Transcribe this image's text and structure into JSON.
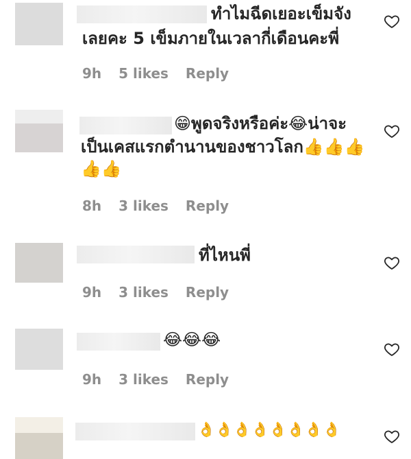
{
  "comments": [
    {
      "text_line1": "ทำไมฉีดเยอะเข็มจัง",
      "text_line2": "เลยคะ 5 เข็มภายในเวลากี่เดือนคะพี่",
      "time": "9h",
      "likes": "5 likes",
      "reply": "Reply",
      "icon": "heart-outline-icon"
    },
    {
      "text_line1": "😁พูดจริงหรือค่ะ😂น่าจะ",
      "text_line2": "เป็นเคสแรกตำนานของชาวโลก👍👍👍",
      "text_line3": "👍👍",
      "time": "8h",
      "likes": "3 likes",
      "reply": "Reply",
      "icon": "heart-outline-icon"
    },
    {
      "text_line1": "ที่ไหนพี่",
      "time": "9h",
      "likes": "3 likes",
      "reply": "Reply",
      "icon": "heart-outline-icon"
    },
    {
      "text_line1": "😂😂😂",
      "time": "9h",
      "likes": "3 likes",
      "reply": "Reply",
      "icon": "heart-outline-icon"
    },
    {
      "text_line1": "👌👌👌👌👌👌👌👌",
      "icon": "heart-outline-icon"
    }
  ],
  "colors": {
    "text": "#262626",
    "meta": "#8e8e8e",
    "background": "#ffffff"
  }
}
